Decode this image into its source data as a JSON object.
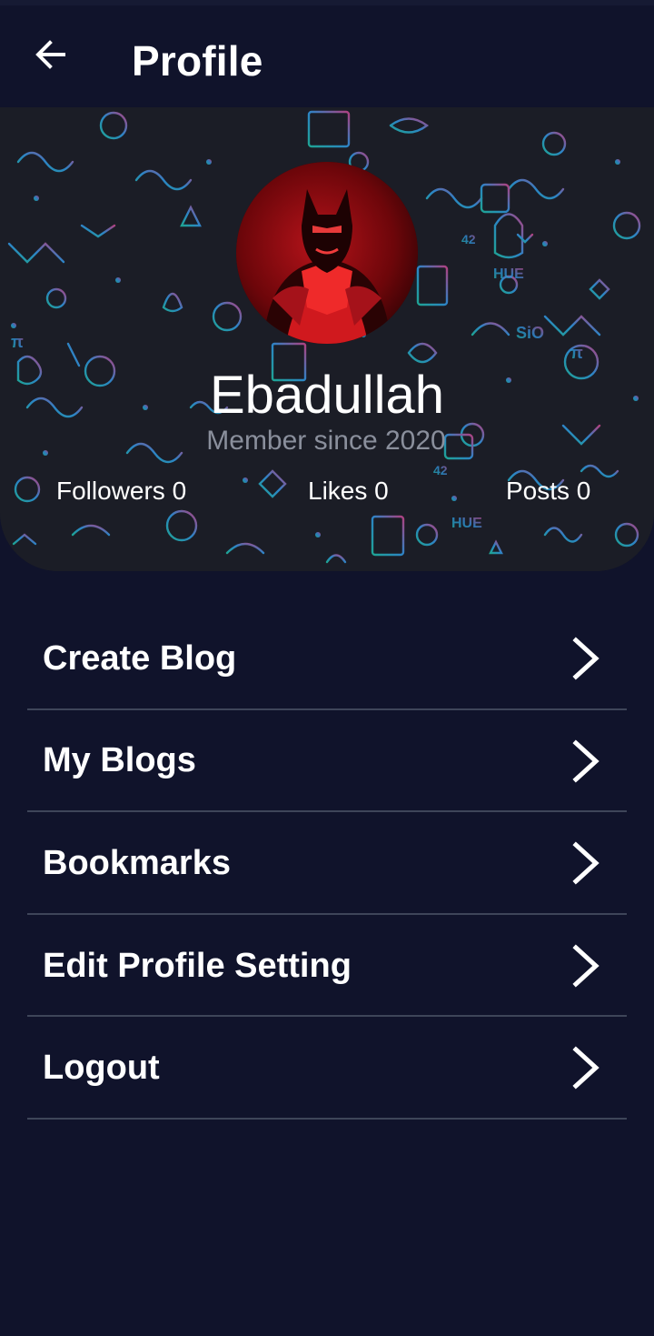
{
  "app_bar": {
    "title": "Profile",
    "back_icon": "arrow-left-icon"
  },
  "profile": {
    "name": "Ebadullah",
    "member_since": "Member since 2020",
    "avatar_icon": "user-avatar-photo",
    "stats": {
      "followers": "Followers 0",
      "likes": "Likes 0",
      "posts": "Posts 0"
    }
  },
  "menu": {
    "items": [
      {
        "label": "Create Blog",
        "icon": "chevron-right-icon"
      },
      {
        "label": "My Blogs",
        "icon": "chevron-right-icon"
      },
      {
        "label": "Bookmarks",
        "icon": "chevron-right-icon"
      },
      {
        "label": "Edit Profile Setting",
        "icon": "chevron-right-icon"
      },
      {
        "label": "Logout",
        "icon": "chevron-right-icon"
      }
    ]
  },
  "colors": {
    "background": "#10132b",
    "header_card": "#1b1d26",
    "divider": "#3e4559",
    "muted_text": "#8a8f9c",
    "doodle_blue": "#2f8fd8",
    "doodle_teal": "#1fb3a0",
    "doodle_pink": "#c0458a",
    "avatar_red": "#c8181c"
  }
}
